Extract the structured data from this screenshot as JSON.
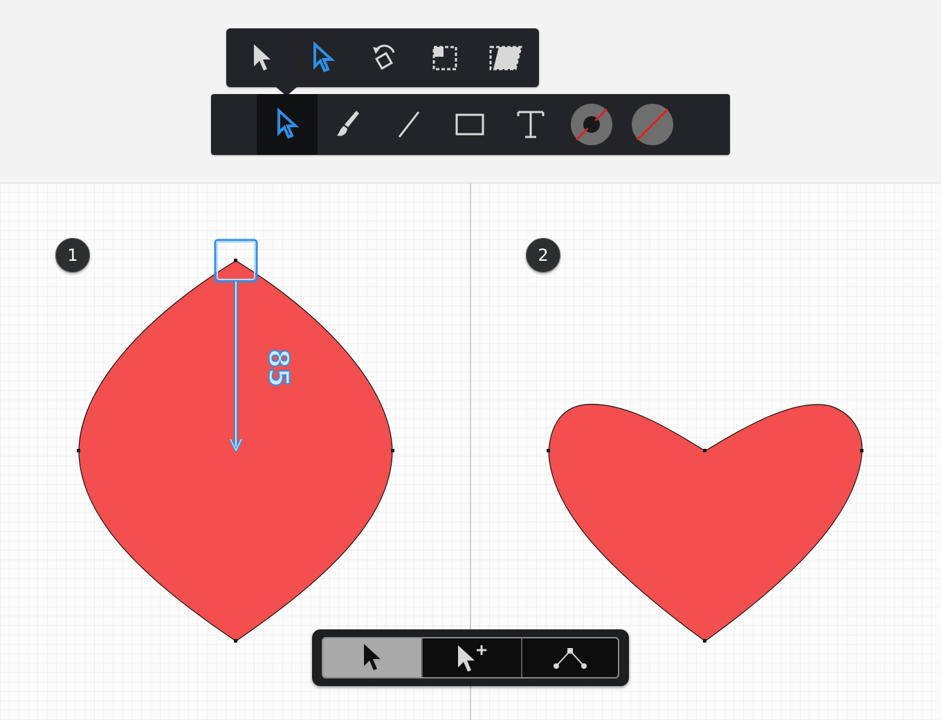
{
  "popover": {
    "tools": [
      {
        "icon": "select-arrow-icon"
      },
      {
        "icon": "direct-select-arrow-icon"
      },
      {
        "icon": "rotate-icon"
      },
      {
        "icon": "scale-icon"
      },
      {
        "icon": "skew-icon"
      }
    ]
  },
  "toolbar": {
    "active_tool": "select",
    "tools": [
      {
        "icon": "select-arrow-icon"
      },
      {
        "icon": "brush-icon"
      },
      {
        "icon": "line-icon"
      },
      {
        "icon": "rectangle-icon"
      },
      {
        "icon": "text-icon"
      },
      {
        "icon": "stroke-color-icon"
      },
      {
        "icon": "fill-color-icon"
      }
    ]
  },
  "canvas": {
    "step1_label": "1",
    "step2_label": "2",
    "drag_measurement": "85",
    "shape_fill": "#f24f4e",
    "accent": "#2e8fe8"
  },
  "node_toolbar": {
    "active": "select",
    "buttons": [
      {
        "icon": "select-node-icon"
      },
      {
        "icon": "add-node-icon"
      },
      {
        "icon": "convert-node-icon"
      }
    ]
  }
}
